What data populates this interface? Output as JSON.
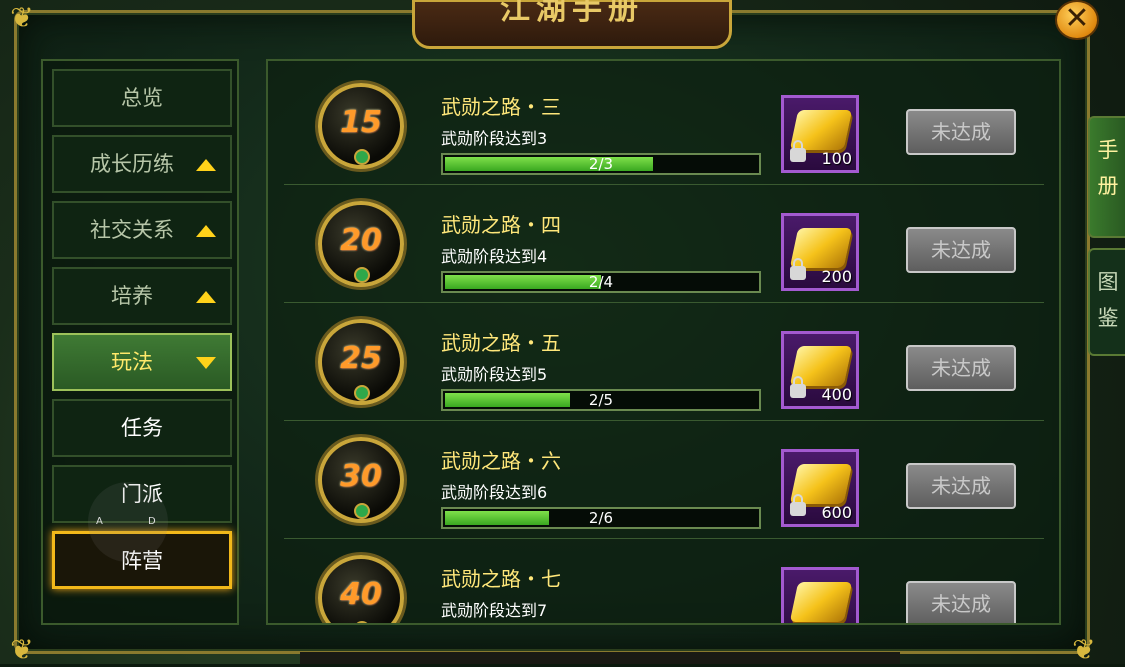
{
  "window": {
    "title": "江湖手册",
    "close_label": "✕"
  },
  "sidebar": {
    "items": [
      {
        "label": "总览",
        "arrow": ""
      },
      {
        "label": "成长历练",
        "arrow": "up"
      },
      {
        "label": "社交关系",
        "arrow": "up"
      },
      {
        "label": "培养",
        "arrow": "up"
      },
      {
        "label": "玩法",
        "arrow": "down",
        "state": "active"
      },
      {
        "label": "任务",
        "arrow": ""
      },
      {
        "label": "门派",
        "arrow": ""
      },
      {
        "label": "阵营",
        "arrow": "",
        "state": "selected"
      }
    ]
  },
  "joystick": {
    "left": "A",
    "right": "D"
  },
  "right_tabs": [
    {
      "label": "手册",
      "active": true
    },
    {
      "label": "图鉴",
      "active": false
    }
  ],
  "achievements": [
    {
      "level": "15",
      "title": "武勋之路・三",
      "desc": "武勋阶段达到3",
      "progress_text": "2/3",
      "progress": 0.6667,
      "reward_amount": "100",
      "button": "未达成"
    },
    {
      "level": "20",
      "title": "武勋之路・四",
      "desc": "武勋阶段达到4",
      "progress_text": "2/4",
      "progress": 0.5,
      "reward_amount": "200",
      "button": "未达成"
    },
    {
      "level": "25",
      "title": "武勋之路・五",
      "desc": "武勋阶段达到5",
      "progress_text": "2/5",
      "progress": 0.4,
      "reward_amount": "400",
      "button": "未达成"
    },
    {
      "level": "30",
      "title": "武勋之路・六",
      "desc": "武勋阶段达到6",
      "progress_text": "2/6",
      "progress": 0.3333,
      "reward_amount": "600",
      "button": "未达成"
    },
    {
      "level": "40",
      "title": "武勋之路・七",
      "desc": "武勋阶段达到7",
      "progress_text": "",
      "progress": 0,
      "reward_amount": "",
      "button": "未达成"
    }
  ],
  "colors": {
    "title_text": "#ffe77a",
    "progress_fill": "#5ccc34",
    "reward_frame": "#a35ad0",
    "highlight_border": "#f2b81a"
  }
}
